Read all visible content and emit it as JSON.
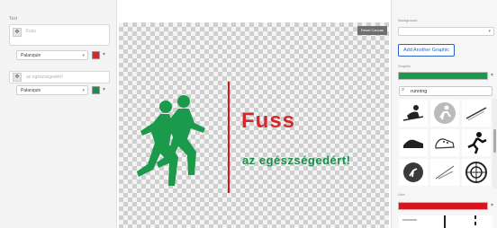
{
  "left_panel": {
    "section_label": "Text",
    "rows": [
      {
        "placeholder": "Fuss",
        "font": "Palanquin",
        "color": "#d8262d"
      },
      {
        "placeholder": "az egészségedért!",
        "font": "Palanquin",
        "color": "#139146"
      }
    ]
  },
  "canvas": {
    "reset_label": "Reset Canvas",
    "headline": "Fuss",
    "subline": "az egészségedért!",
    "graphic_color": "#1a9a4a",
    "accent_color": "#d6151c"
  },
  "right_panel": {
    "background_label": "Background",
    "add_graphic_label": "Add Another Graphic",
    "graphic_label": "Graphic",
    "graphic_color": "#1a9a4a",
    "search_value": "running",
    "icons": [
      "skier-icon",
      "runner-circle-icon",
      "ski-pole-icon",
      "sneaker-icon",
      "running-shoe-icon",
      "sprinter-icon",
      "running-track-icon",
      "runner-badge-icon",
      "compass-icon"
    ],
    "line_label": "Line",
    "line_color": "#d6151c"
  }
}
